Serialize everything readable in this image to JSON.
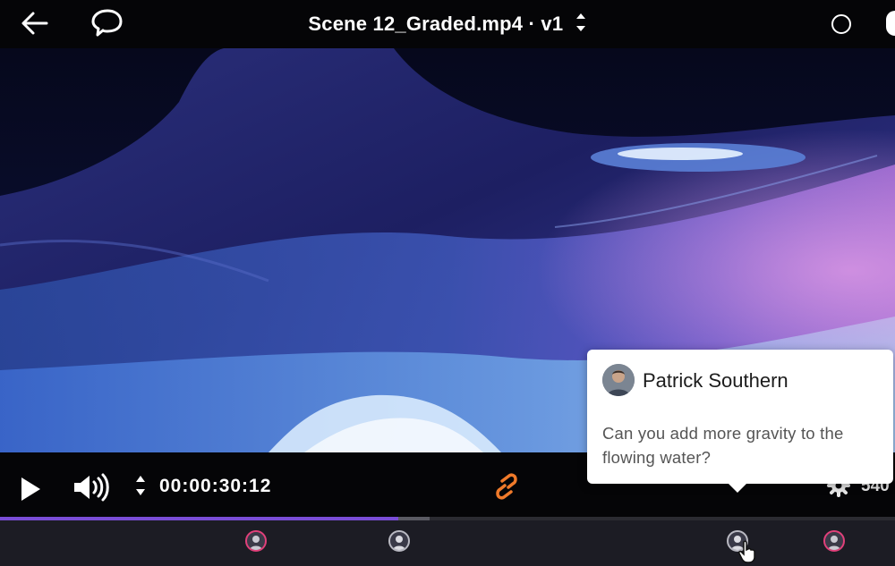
{
  "header": {
    "title": "Scene 12_Graded.mp4 · v1",
    "back_icon": "arrow-left-icon",
    "comments_icon": "speech-bubble-icon",
    "version_icon": "chevron-up-down-icon",
    "status_icon": "circle-outline-icon"
  },
  "player": {
    "timecode": "00:00:30:12",
    "resolution": "540",
    "progress": 0.445,
    "buffered": 0.48,
    "accent_color": "#7a4dd6",
    "play_icon": "play-icon",
    "volume_icon": "volume-icon",
    "sync_icon": "sync-link-icon",
    "settings_icon": "gear-icon"
  },
  "comment_popup": {
    "author": "Patrick Southern",
    "text": "Can you add more gravity to the flowing water?"
  },
  "timeline": {
    "markers": [
      "avatar-pink",
      "avatar-grey",
      "avatar-grey-active",
      "avatar-pink"
    ]
  }
}
